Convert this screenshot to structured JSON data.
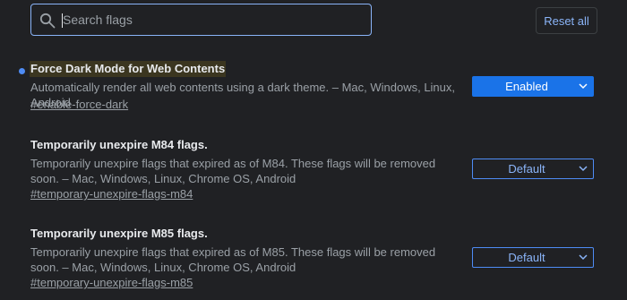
{
  "search": {
    "placeholder": "Search flags",
    "value": ""
  },
  "toolbar": {
    "reset_label": "Reset all"
  },
  "colors": {
    "background": "#202124",
    "accent": "#8ab4f8",
    "enabled_fill": "#1a73e8",
    "modified_dot": "#4e8cf5",
    "highlight": "#3b3620"
  },
  "flags": [
    {
      "title": "Force Dark Mode for Web Contents",
      "description": "Automatically render all web contents using a dark theme. – Mac, Windows, Linux, Android",
      "link": "#enable-force-dark",
      "select_value": "Enabled",
      "modified": true
    },
    {
      "title": "Temporarily unexpire M84 flags.",
      "description": "Temporarily unexpire flags that expired as of M84. These flags will be removed soon. – Mac, Windows, Linux, Chrome OS, Android",
      "link": "#temporary-unexpire-flags-m84",
      "select_value": "Default",
      "modified": false
    },
    {
      "title": "Temporarily unexpire M85 flags.",
      "description": "Temporarily unexpire flags that expired as of M85. These flags will be removed soon. – Mac, Windows, Linux, Chrome OS, Android",
      "link": "#temporary-unexpire-flags-m85",
      "select_value": "Default",
      "modified": false
    }
  ],
  "icons": {
    "search": "search-icon",
    "dropdown": "chevron-down-icon",
    "modified": "modified-dot-icon"
  }
}
